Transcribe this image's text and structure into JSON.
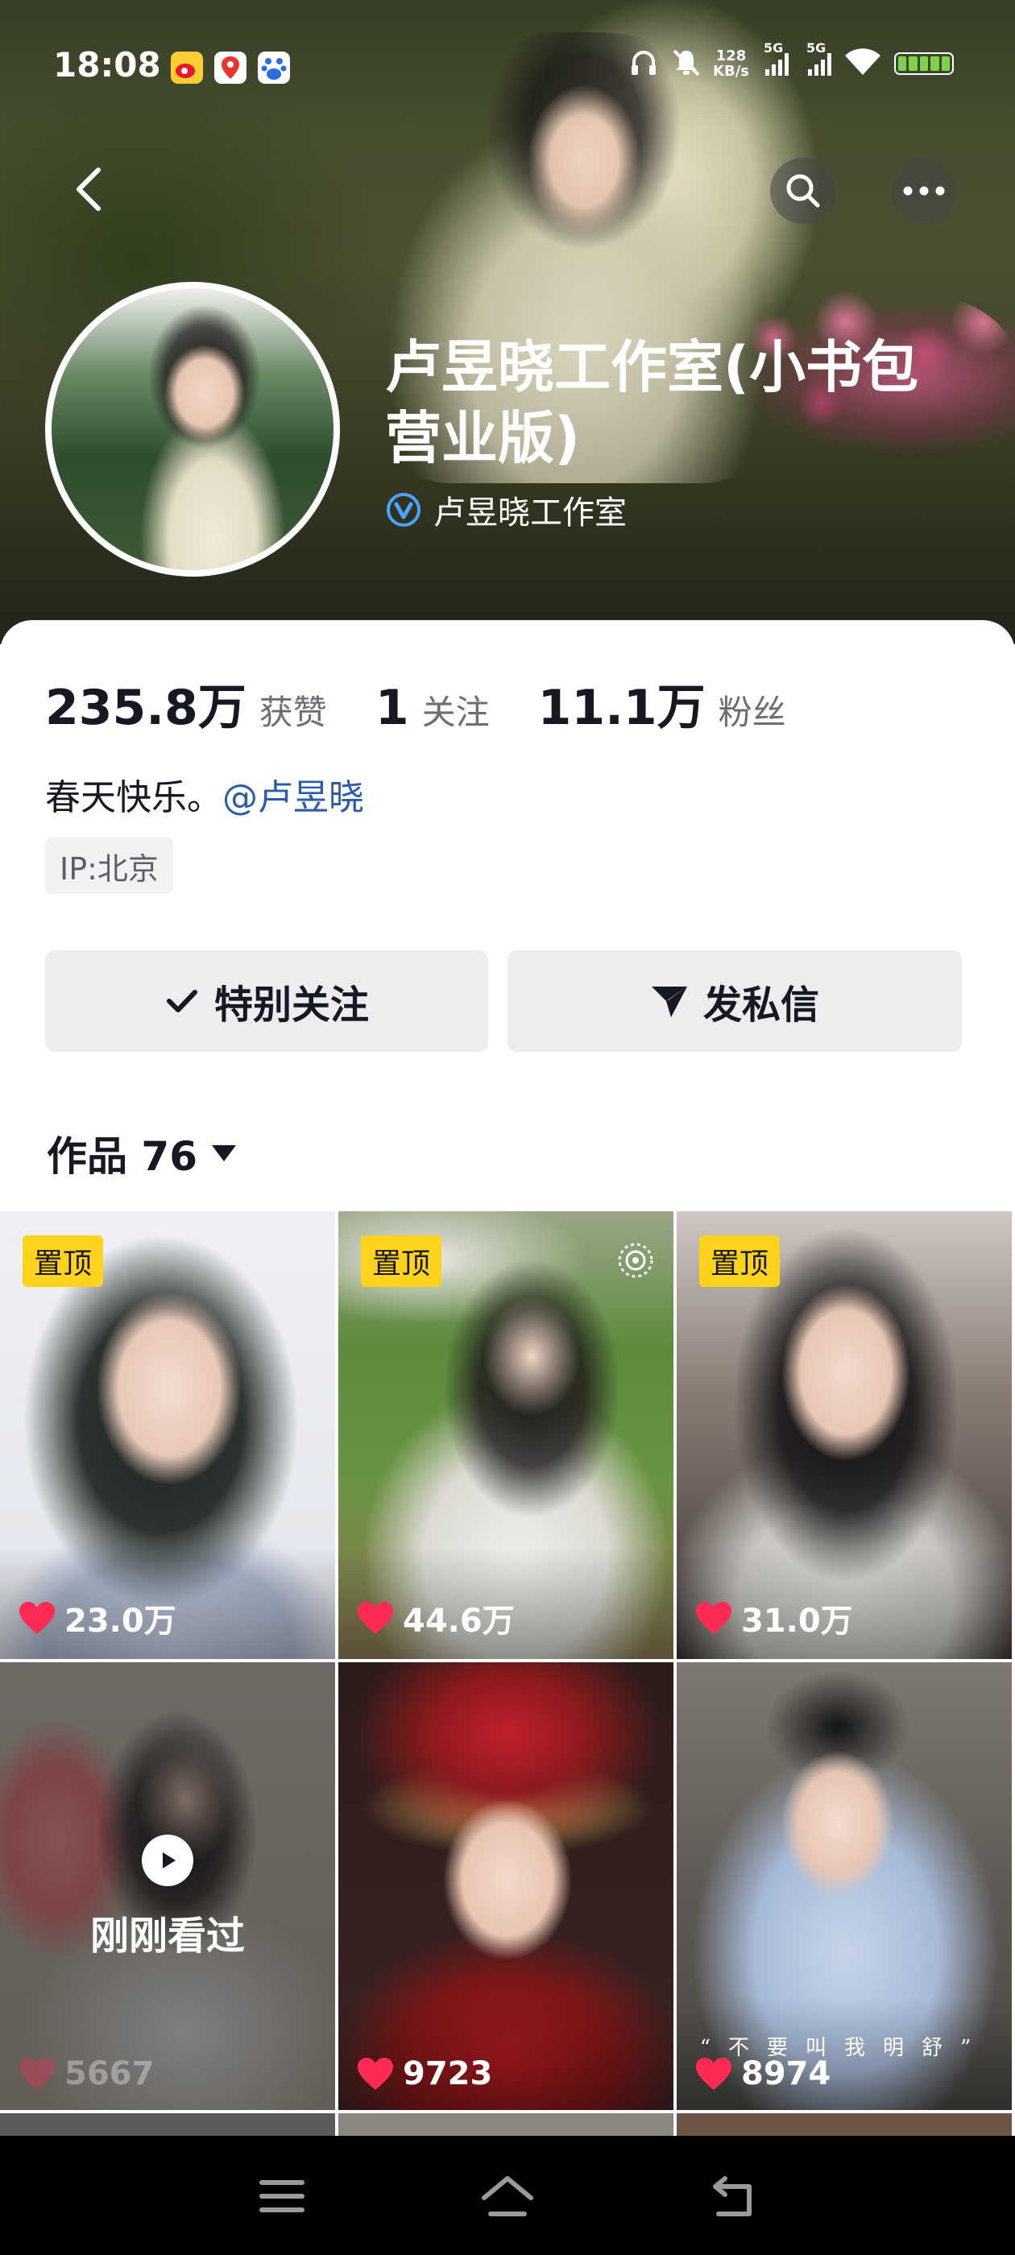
{
  "status_bar": {
    "time": "18:08",
    "net_speed_value": "128",
    "net_speed_unit": "KB/s",
    "signal_label_1": "5G",
    "signal_label_2": "5G",
    "app_icons": [
      "weibo-icon",
      "map-icon",
      "baidu-icon"
    ],
    "status_icons": [
      "headphones-icon",
      "mute-icon",
      "signal-icon",
      "signal-icon",
      "wifi-icon",
      "battery-icon"
    ]
  },
  "header": {
    "back_icon": "back-arrow-icon",
    "search_icon": "search-icon",
    "more_icon": "more-icon"
  },
  "profile": {
    "name": "卢昱晓工作室(小书包营业版)",
    "verified_text": "卢昱晓工作室",
    "verified_icon": "verified-badge-icon"
  },
  "stats": [
    {
      "value": "235.8万",
      "label": "获赞"
    },
    {
      "value": "1",
      "label": "关注"
    },
    {
      "value": "11.1万",
      "label": "粉丝"
    }
  ],
  "bio": {
    "text": "春天快乐。",
    "mention": "@卢昱晓"
  },
  "ip": "IP:北京",
  "actions": {
    "follow_label": "特别关注",
    "message_label": "发私信"
  },
  "works_tab": {
    "label": "作品 76"
  },
  "videos": [
    {
      "pinned": true,
      "pin_label": "置顶",
      "likes": "23.0万"
    },
    {
      "pinned": true,
      "pin_label": "置顶",
      "likes": "44.6万"
    },
    {
      "pinned": true,
      "pin_label": "置顶",
      "likes": "31.0万"
    },
    {
      "pinned": false,
      "likes": "5667",
      "recent_label": "刚刚看过"
    },
    {
      "pinned": false,
      "likes": "9723"
    },
    {
      "pinned": false,
      "likes": "8974",
      "caption": "“不要叫我明舒”"
    }
  ],
  "colors": {
    "accent_blue": "#2a5ca8",
    "pin_yellow": "#ffd21e",
    "like_red": "#fe2c55",
    "verified_blue": "#4aa3ff"
  }
}
